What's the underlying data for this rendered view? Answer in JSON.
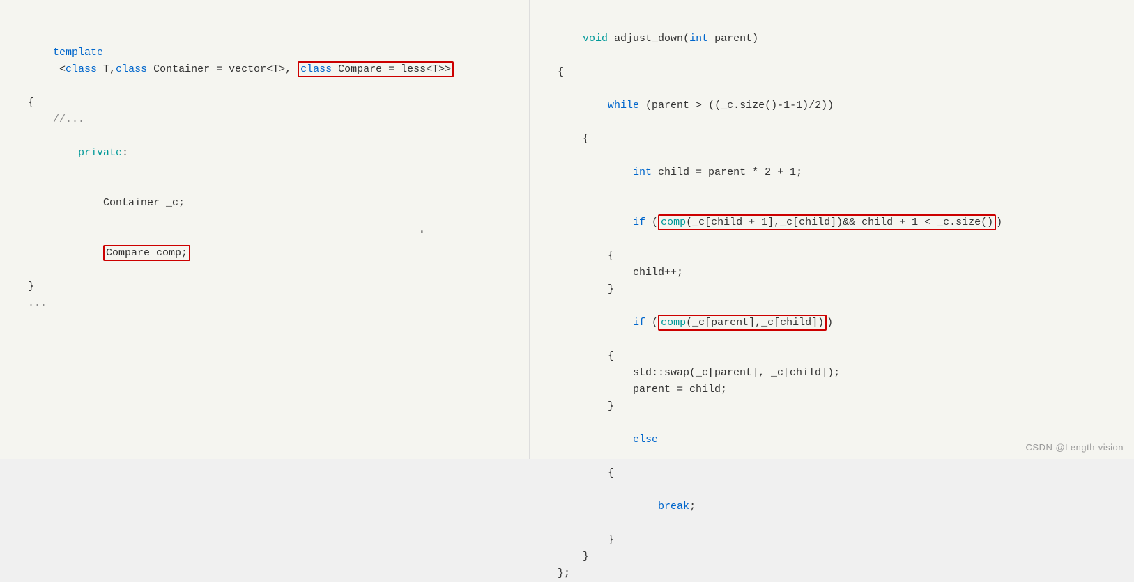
{
  "left": {
    "lines": [
      {
        "id": "l1",
        "type": "template"
      },
      {
        "id": "l2",
        "text": "{"
      },
      {
        "id": "l3",
        "text": "    //..."
      },
      {
        "id": "l4",
        "text": "    private:"
      },
      {
        "id": "l5",
        "text": "        Container _c;"
      },
      {
        "id": "l6",
        "text": "        Compare comp;"
      },
      {
        "id": "l7",
        "text": "}"
      },
      {
        "id": "l8",
        "text": "..."
      }
    ]
  },
  "right": {
    "lines": [
      {
        "id": "r1",
        "text": "void adjust_down(int parent)"
      },
      {
        "id": "r2",
        "text": "{"
      },
      {
        "id": "r3",
        "text": "    while (parent > ((_c.size()-1-1)/2))"
      },
      {
        "id": "r4",
        "text": "    {"
      },
      {
        "id": "r5",
        "text": "        int child = parent * 2 + 1;"
      },
      {
        "id": "r6",
        "text": "        if (comp(_c[child + 1],_c[child])&& child + 1 < _c.size())"
      },
      {
        "id": "r7",
        "text": "        {"
      },
      {
        "id": "r8",
        "text": "            child++;"
      },
      {
        "id": "r9",
        "text": "        }"
      },
      {
        "id": "r10",
        "text": "        if (comp(_c[parent],_c[child]))"
      },
      {
        "id": "r11",
        "text": "        {"
      },
      {
        "id": "r12",
        "text": "            std::swap(_c[parent], _c[child]);"
      },
      {
        "id": "r13",
        "text": "            parent = child;"
      },
      {
        "id": "r14",
        "text": "        }"
      },
      {
        "id": "r15",
        "text": "        else"
      },
      {
        "id": "r16",
        "text": "        {"
      },
      {
        "id": "r17",
        "text": "            break;"
      },
      {
        "id": "r18",
        "text": "        }"
      },
      {
        "id": "r19",
        "text": "    }"
      },
      {
        "id": "r20",
        "text": "};"
      }
    ]
  },
  "watermark": "CSDN @Length-vision"
}
